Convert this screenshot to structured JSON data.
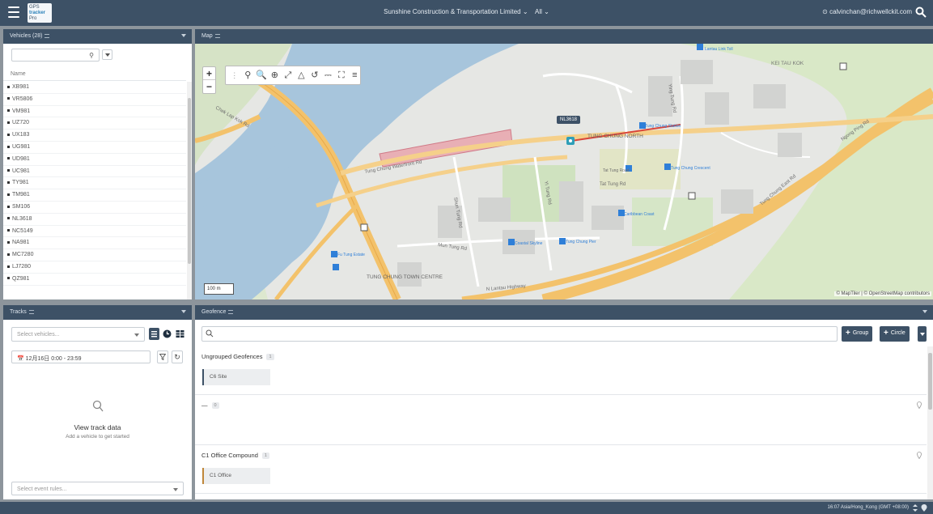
{
  "header": {
    "logo_line1": "GPS",
    "logo_line2": "tracker",
    "logo_line3": "Pro",
    "company_selector": "Sunshine Construction & Transportation Limited ⌄",
    "scope_selector": "All ⌄",
    "user_email": "⊙ calvinchan@richwellckit.com"
  },
  "vehicles_panel": {
    "title": "Vehicles (28)",
    "column_name": "Name",
    "items": [
      "XB981",
      "VR5806",
      "VM981",
      "UZ720",
      "UX183",
      "UG981",
      "UD981",
      "UC981",
      "TY981",
      "TM981",
      "SM106",
      "NL3618",
      "NC5149",
      "NA981",
      "MC7280",
      "LJ7280",
      "QZ981"
    ]
  },
  "map_panel": {
    "title": "Map",
    "scale_label": "100 m",
    "attribution": "© MapTiler | © OpenStreetMap contributors",
    "vehicle_marker": "NL3618",
    "labels": {
      "kei_tau_kok": "KEI TAU KOK",
      "tung_chung_north": "TUNG CHUNG NORTH",
      "tung_chung_centre": "TUNG CHUNG TOWN CENTRE",
      "tung_chung_waterfront": "Tung Chung Waterfront Rd",
      "tat_tung_rd": "Tat Tung Rd",
      "lantau_hwy": "N Lantau Highway",
      "shun_tung_rd": "Shun Tung Rd",
      "yi_tung_rd": "Yi Tung Rd",
      "mun_tung_rd": "Mun Tung Rd",
      "ying_tung_rd": "Ying Tung Rd",
      "chek_lap_kok": "Chek Lap Kok Rd",
      "tung_chung_station": "Tung Chung Station",
      "tung_chung_crescent": "Tung Chung Crescent",
      "tung_chung_east": "Tung Chung East Rd",
      "ngong_ping": "Ngong Ping Rd",
      "tat_tung": "Tat Tung Road",
      "caribbean_coast": "Caribbean Coast",
      "coastal_skyline": "Coastal Skyline",
      "fu_tung_estate": "Fu Tung Estate",
      "tung_chung_pier": "Tung Chung Pier",
      "lantau_station": "Lantau Link Toll"
    }
  },
  "tracks_panel": {
    "title": "Tracks",
    "vehicle_placeholder": "Select vehicles...",
    "date_range": "12月16日 0:00 - 23:59",
    "empty_title": "View track data",
    "empty_subtitle": "Add a vehicle to get started",
    "event_rules_placeholder": "Select event rules..."
  },
  "geofence_panel": {
    "title": "Geofence",
    "add_group_label": "Group",
    "add_circle_label": "Circle",
    "groups": [
      {
        "name": "Ungrouped Geofences",
        "count": "1",
        "items": [
          "C6 Site"
        ]
      },
      {
        "name": "—",
        "count": "0",
        "items": []
      },
      {
        "name": "C1 Office Compound",
        "count": "1",
        "items": [
          "C1 Office"
        ]
      }
    ]
  },
  "footer": {
    "timezone": "16:07 Asia/Hong_Kong (GMT +08:00)"
  },
  "colors": {
    "header_bg": "#3d5166",
    "water": "#a7c5dc",
    "highway": "#f3c26b",
    "geofence_fill": "#e8a4ad",
    "track_line": "#d9463a"
  }
}
